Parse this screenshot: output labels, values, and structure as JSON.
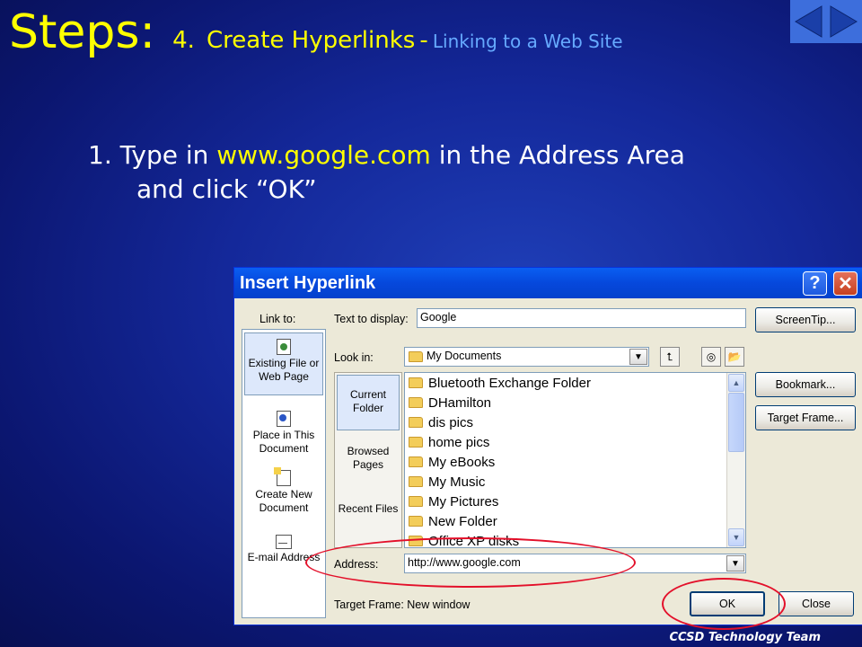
{
  "slide": {
    "title_main": "Steps:",
    "title_num": "4.",
    "title_topic": "Create Hyperlinks",
    "title_sep": "-",
    "title_sub": "Linking to a Web Site",
    "step_num": "1.",
    "step_pre": "Type in",
    "step_url": "www.google.com",
    "step_post": "in the Address Area",
    "step_line2": "and click “OK”",
    "footer": "CCSD Technology Team",
    "nav": [
      "prev-arrow-icon",
      "next-arrow-icon"
    ],
    "colors": {
      "title": "#ffff00",
      "subtitle": "#66aaff",
      "highlight": "#ffff00",
      "annotation": "#e3102a"
    }
  },
  "dialog": {
    "title": "Insert Hyperlink",
    "help": "?",
    "close": "✕",
    "link_to_label": "Link to:",
    "link_to": [
      {
        "label": "Existing File or Web Page"
      },
      {
        "label": "Place in This Document"
      },
      {
        "label": "Create New Document"
      },
      {
        "label": "E-mail Address"
      }
    ],
    "text_to_display_label": "Text to display:",
    "text_to_display_value": "Google",
    "screentip": "ScreenTip...",
    "look_in_label": "Look in:",
    "look_in_value": "My Documents",
    "places": [
      "Current Folder",
      "Browsed Pages",
      "Recent Files"
    ],
    "files": [
      "Bluetooth Exchange Folder",
      "DHamilton",
      "dis pics",
      "home pics",
      "My eBooks",
      "My Music",
      "My Pictures",
      "New Folder",
      "Office XP disks"
    ],
    "bookmark": "Bookmark...",
    "target_frame_btn": "Target Frame...",
    "address_label": "Address:",
    "address_value": "http://www.google.com",
    "target_frame_text": "Target Frame: New window",
    "ok": "OK",
    "close_btn": "Close"
  }
}
